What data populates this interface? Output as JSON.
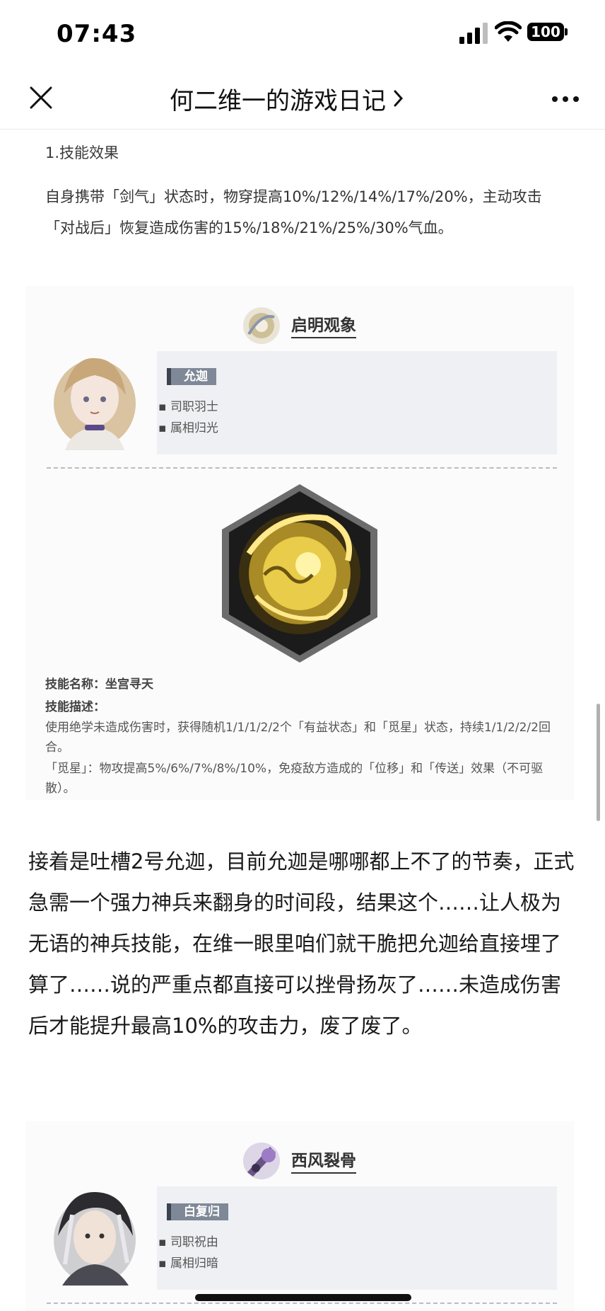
{
  "status_bar": {
    "time": "07:43",
    "battery": "100"
  },
  "nav": {
    "title": "何二维一的游戏日记",
    "icons": [
      "close-icon",
      "chevron-right-icon",
      "more-icon"
    ]
  },
  "article": {
    "section_heading": "1.技能效果",
    "effect_text": "自身携带「剑气」状态时，物穿提高10%/12%/14%/17%/20%，主动攻击「对战后」恢复造成伤害的15%/18%/21%/25%/30%气血。",
    "card1": {
      "weapon_name": "启明观象",
      "character": "允迦",
      "role": "司职羽士",
      "attribute": "属相归光",
      "skill_name_label": "技能名称：坐宫寻天",
      "skill_desc_label": "技能描述：",
      "skill_desc_1": "使用绝学未造成伤害时，获得随机1/1/1/2/2个「有益状态」和「觅星」状态，持续1/1/2/2/2回合。",
      "skill_desc_2": "「觅星」：物攻提高5%/6%/7%/8%/10%，免疫敌方造成的「位移」和「传送」效果（不可驱散）。"
    },
    "commentary": "接着是吐槽2号允迦，目前允迦是哪哪都上不了的节奏，正式急需一个强力神兵来翻身的时间段，结果这个……让人极为无语的神兵技能，在维一眼里咱们就干脆把允迦给直接埋了算了……说的严重点都直接可以挫骨扬灰了……未造成伤害后才能提升最高10%的攻击力，废了废了。",
    "card2": {
      "weapon_name": "西风裂骨",
      "character": "白复归",
      "role": "司职祝由",
      "attribute": "属相归暗"
    }
  }
}
